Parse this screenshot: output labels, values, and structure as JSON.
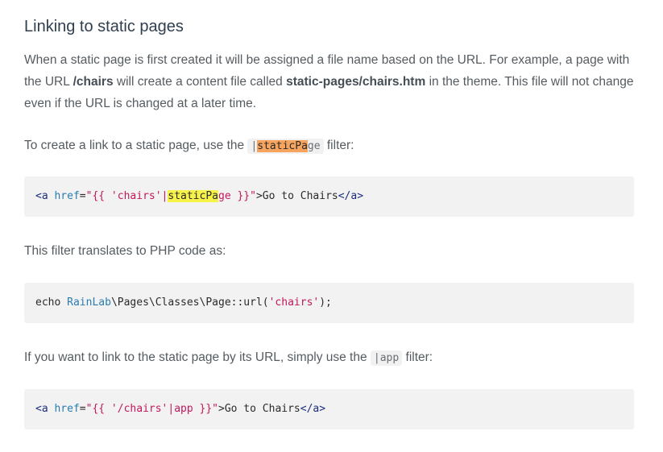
{
  "heading": "Linking to static pages",
  "intro": {
    "part1": "When a static page is first created it will be assigned a file name based on the URL. For example, a page with the URL ",
    "url_bold": "/chairs",
    "part2": " will create a content file called ",
    "file_bold": "static-pages/chairs.htm",
    "part3": " in the theme. This file will not change even if the URL is changed at a later time."
  },
  "para2": {
    "before": "To create a link to a static page, use the ",
    "code_pipe": "|",
    "code_highlight": "staticPa",
    "code_rest": "ge",
    "after": " filter:"
  },
  "code1": {
    "tag_open": "<a",
    "attr": "href",
    "eq": "=",
    "str_a": "\"{{ 'chairs'|",
    "highlight": "staticPa",
    "str_b": "ge }}\"",
    "gt": ">",
    "text": "Go to Chairs",
    "tag_close": "</a>"
  },
  "para3": "This filter translates to PHP code as:",
  "code2": {
    "echo": "echo ",
    "ns": "RainLab",
    "rest": "\\Pages\\Classes\\Page::url(",
    "arg": "'chairs'",
    "end": ");"
  },
  "para4": {
    "before": "If you want to link to the static page by its URL, simply use the ",
    "code": "|app",
    "after": " filter:"
  },
  "code3": {
    "tag_open": "<a",
    "attr": "href",
    "eq": "=",
    "str": "\"{{ '/chairs'|app }}\"",
    "gt": ">",
    "text": "Go to Chairs",
    "tag_close": "</a>"
  }
}
